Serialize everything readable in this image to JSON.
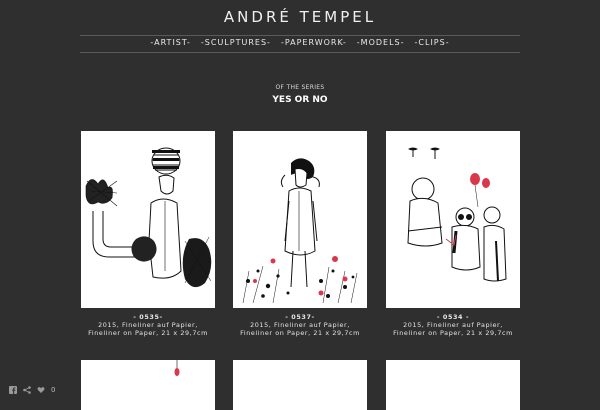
{
  "site": {
    "title": "ANDRÉ TEMPEL"
  },
  "nav": [
    {
      "label": "-ARTIST-"
    },
    {
      "label": "-SCULPTURES-"
    },
    {
      "label": "-PAPERWORK-"
    },
    {
      "label": "-MODELS-"
    },
    {
      "label": "-CLIPS-"
    }
  ],
  "series": {
    "label": "OF THE SERIES",
    "title": "YES OR NO"
  },
  "works": [
    {
      "code": "- 0535-",
      "line1": "2015, Fineliner auf Papier,",
      "line2": "Fineliner on Paper, 21 x 29,7cm"
    },
    {
      "code": "- 0537-",
      "line1": "2015, Fineliner auf Papier,",
      "line2": "Fineliner on Paper, 21 x 29,7cm"
    },
    {
      "code": "- 0534 -",
      "line1": "2015, Fineliner auf Papier,",
      "line2": "Fineliner on Paper, 21 x 29,7cm"
    }
  ],
  "social": {
    "like_count": "0",
    "icons": [
      "facebook-icon",
      "share-icon",
      "heart-icon"
    ]
  },
  "colors": {
    "background": "#2f2f2f",
    "accent_red": "#d9374b"
  }
}
